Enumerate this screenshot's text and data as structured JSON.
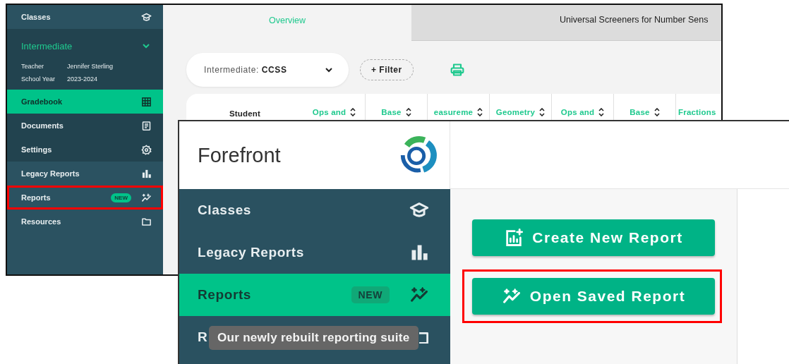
{
  "back_window": {
    "sidebar": [
      {
        "kind": "nav",
        "label": "Classes",
        "selected": false,
        "highlighted": false
      },
      {
        "kind": "class",
        "name": "Intermediate",
        "expanded": true,
        "details": [
          {
            "label": "Teacher",
            "value": "Jennifer Sterling"
          },
          {
            "label": "School Year",
            "value": "2023-2024"
          }
        ],
        "children": [
          {
            "label": "Gradebook",
            "selected": true,
            "highlighted": false
          },
          {
            "label": "Documents",
            "selected": false,
            "highlighted": false
          },
          {
            "label": "Settings",
            "selected": false,
            "highlighted": false
          }
        ]
      },
      {
        "kind": "nav",
        "label": "Legacy Reports",
        "selected": false,
        "highlighted": false
      },
      {
        "kind": "nav",
        "label": "Reports",
        "badge": "NEW",
        "selected": false,
        "highlighted": true
      },
      {
        "kind": "nav",
        "label": "Resources",
        "selected": false,
        "highlighted": false
      }
    ],
    "tabs": [
      {
        "label": "Overview",
        "selected": true
      },
      {
        "label": "Universal Screeners for Number Sens",
        "selected": false
      }
    ],
    "standard_select": {
      "label": "Intermediate:",
      "value": "CCSS"
    },
    "filter_button": "+ Filter",
    "table": {
      "columns": [
        {
          "label": "Student",
          "sortable": false
        },
        {
          "label": "Ops and",
          "sortable": true
        },
        {
          "label": "Base",
          "sortable": true
        },
        {
          "label": "easureme",
          "sortable": true
        },
        {
          "label": "Geometry",
          "sortable": true
        },
        {
          "label": "Ops and",
          "sortable": true
        },
        {
          "label": "Base",
          "sortable": true
        },
        {
          "label": "Fractions"
        }
      ]
    }
  },
  "front_window": {
    "brand": "Forefront",
    "sidebar": [
      {
        "label": "Classes",
        "selected": false
      },
      {
        "label": "Legacy Reports",
        "selected": false
      },
      {
        "label": "Reports",
        "badge": "NEW",
        "selected": true
      },
      {
        "label": "R",
        "selected": false
      }
    ],
    "tooltip": "Our newly rebuilt reporting suite",
    "actions": [
      {
        "label": "Create New Report",
        "highlighted": false
      },
      {
        "label": "Open Saved Report",
        "highlighted": true
      }
    ]
  }
}
